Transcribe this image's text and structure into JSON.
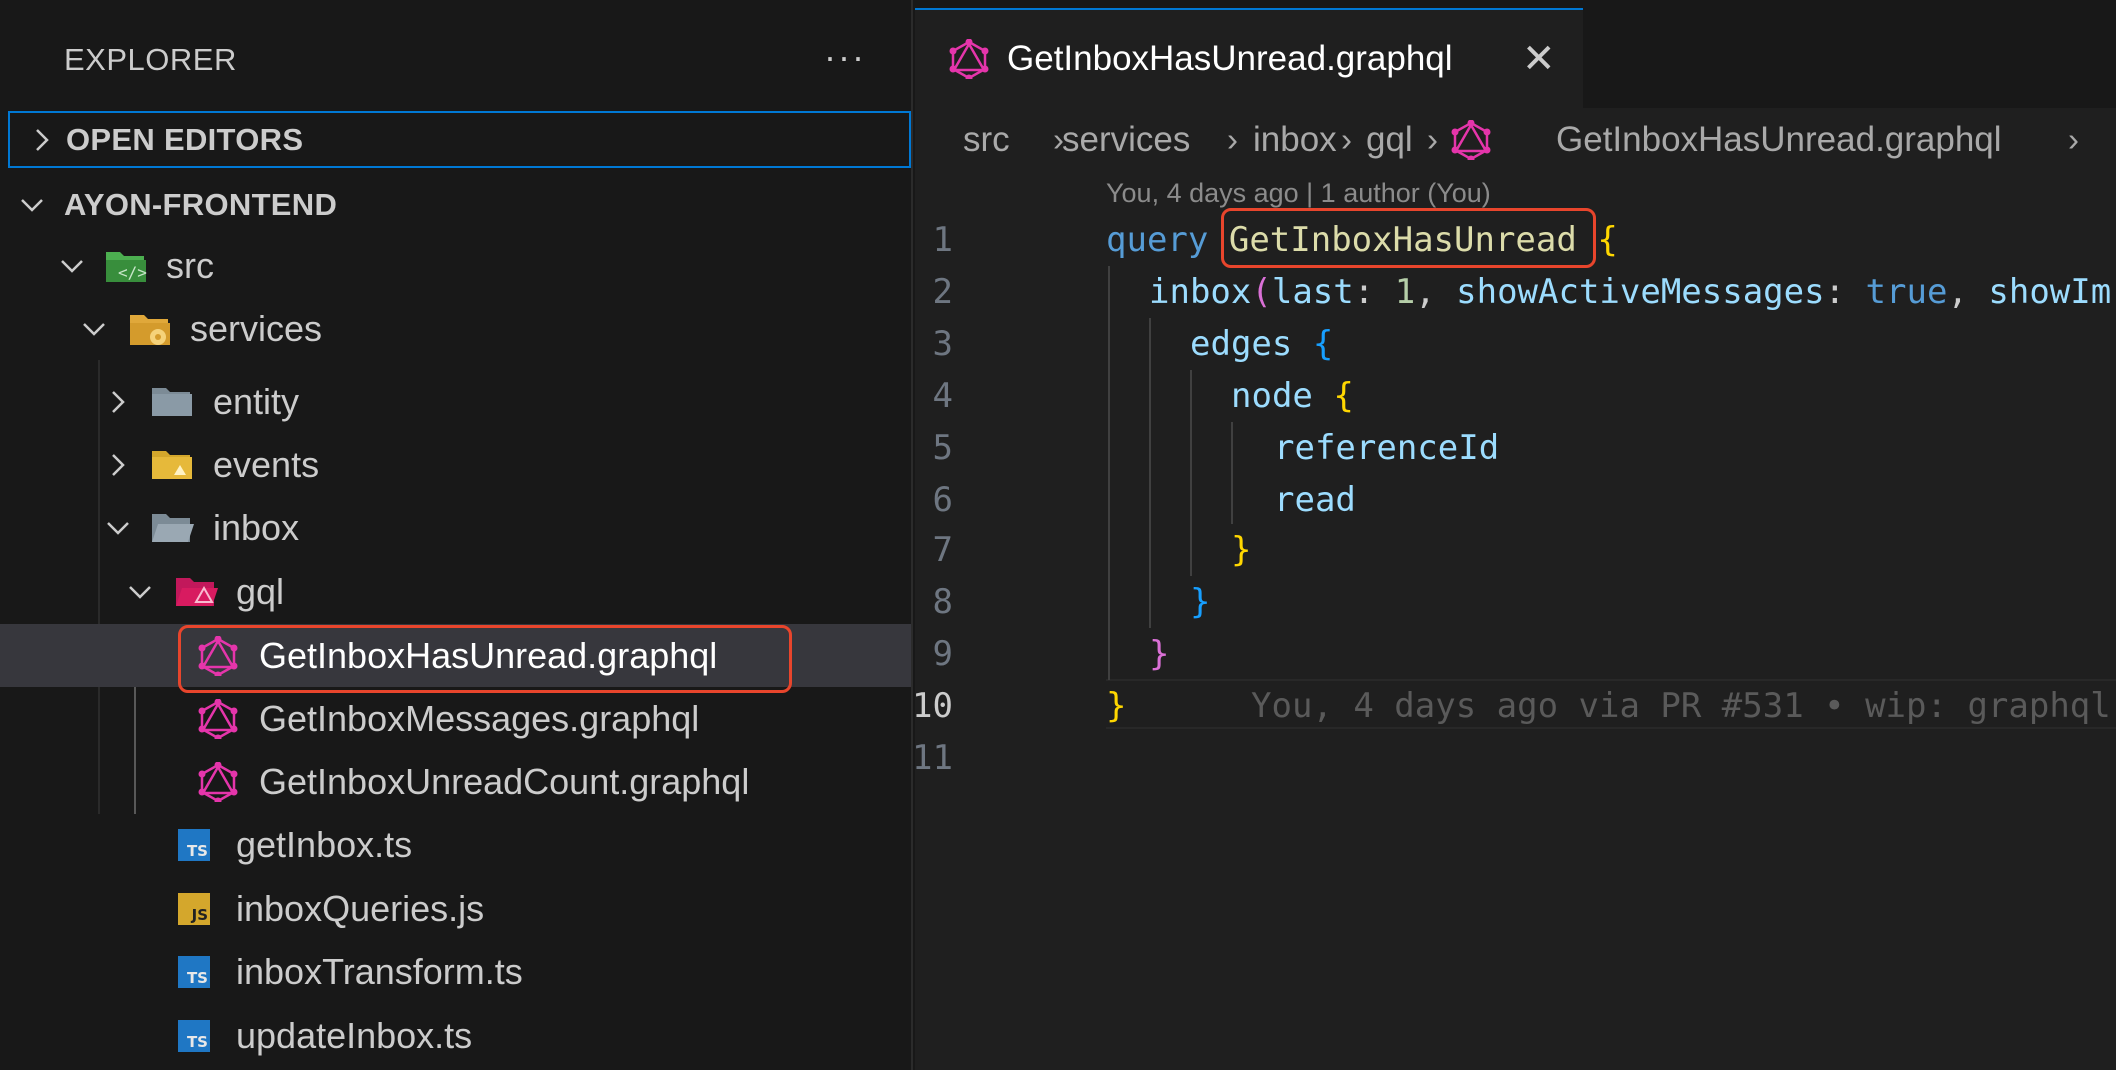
{
  "sidebar": {
    "title": "EXPLORER",
    "more_label": "···",
    "open_editors_label": "OPEN EDITORS",
    "project_label": "AYON-FRONTEND",
    "tree": [
      {
        "label": "src",
        "icon": "folder-src-icon"
      },
      {
        "label": "services",
        "icon": "folder-services-icon"
      },
      {
        "label": "entity",
        "icon": "folder-icon"
      },
      {
        "label": "events",
        "icon": "folder-events-icon"
      },
      {
        "label": "inbox",
        "icon": "folder-open-icon"
      },
      {
        "label": "gql",
        "icon": "folder-graphql-icon"
      },
      {
        "label": "GetInboxHasUnread.graphql",
        "icon": "graphql-icon"
      },
      {
        "label": "GetInboxMessages.graphql",
        "icon": "graphql-icon"
      },
      {
        "label": "GetInboxUnreadCount.graphql",
        "icon": "graphql-icon"
      },
      {
        "label": "getInbox.ts",
        "icon": "typescript-icon"
      },
      {
        "label": "inboxQueries.js",
        "icon": "javascript-icon"
      },
      {
        "label": "inboxTransform.ts",
        "icon": "typescript-icon"
      },
      {
        "label": "updateInbox.ts",
        "icon": "typescript-icon"
      }
    ]
  },
  "editor": {
    "tab_label": "GetInboxHasUnread.graphql",
    "tab_close": "✕",
    "breadcrumb": [
      "src",
      "services",
      "inbox",
      "gql",
      "GetInboxHasUnread.graphql"
    ],
    "blame_header": "You, 4 days ago | 1 author (You)",
    "line_numbers": [
      "1",
      "2",
      "3",
      "4",
      "5",
      "6",
      "7",
      "8",
      "9",
      "10",
      "11"
    ],
    "code": {
      "l1_kw": "query",
      "l1_name": "GetInboxHasUnread",
      "l1_brace": "{",
      "l2_field": "inbox",
      "l2_paren": "(",
      "l2_arg1": "last",
      "l2_colon1": ": ",
      "l2_val1": "1",
      "l2_comma1": ", ",
      "l2_arg2": "showActiveMessages",
      "l2_colon2": ": ",
      "l2_val2": "true",
      "l2_comma2": ", ",
      "l2_arg3": "showIm",
      "l3_field": "edges",
      "l3_brace": "{",
      "l4_field": "node",
      "l4_brace": "{",
      "l5_field": "referenceId",
      "l6_field": "read",
      "l7_brace": "}",
      "l8_brace": "}",
      "l9_brace": "}",
      "l10_brace": "}",
      "l10_blame": "You, 4 days ago via PR #531 • wip: graphql"
    },
    "colors": {
      "keyword": "#569cd6",
      "function": "#dcdcaa",
      "property": "#9cdcfe",
      "highlight": "#e8452c",
      "graphql": "#e535ab"
    }
  }
}
